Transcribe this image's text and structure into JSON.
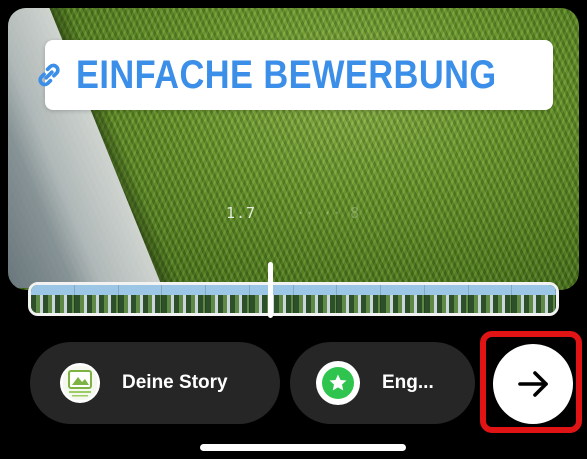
{
  "sticker": {
    "text": "EINFACHE BEWERBUNG",
    "icon": "link-icon",
    "color": "#3c8fe8"
  },
  "timeline": {
    "time_label": "1.7",
    "time_ghost": "·· ·· 8"
  },
  "share_targets": [
    {
      "label": "Deine Story",
      "icon": "story-avatar"
    },
    {
      "label": "Eng...",
      "icon": "star-icon",
      "accent": "#2fc44e"
    }
  ],
  "next_button": {
    "icon": "arrow-right-icon"
  },
  "highlight_color": "#e01414"
}
